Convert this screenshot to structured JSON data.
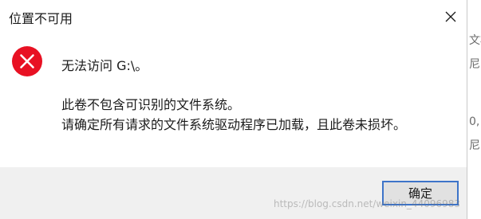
{
  "dialog": {
    "title": "位置不可用",
    "close_glyph": "✕",
    "icon": "error-icon",
    "headline": "无法访问 G:\\。",
    "body_lines": [
      "此卷不包含可识别的文件系统。",
      "请确定所有请求的文件系统驱动程序已加载，且此卷未损坏。"
    ],
    "ok_label": "确定"
  },
  "background_fragments": [
    "文相",
    "尼",
    "0,",
    "尼"
  ],
  "watermark": "https://blog.csdn.net/weixin_44096983",
  "colors": {
    "error_red": "#e81123",
    "button_border": "#3d74c9",
    "footer_bg": "#f0f0f0"
  }
}
